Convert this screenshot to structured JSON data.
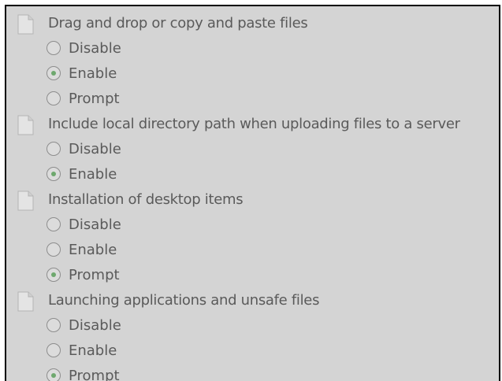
{
  "settings": [
    {
      "label": "Drag and drop or copy and paste files",
      "icon": "document-icon",
      "options": [
        {
          "label": "Disable",
          "checked": false
        },
        {
          "label": "Enable",
          "checked": true
        },
        {
          "label": "Prompt",
          "checked": false
        }
      ]
    },
    {
      "label": "Include local directory path when uploading files to a server",
      "icon": "document-icon",
      "options": [
        {
          "label": "Disable",
          "checked": false
        },
        {
          "label": "Enable",
          "checked": true
        }
      ]
    },
    {
      "label": "Installation of desktop items",
      "icon": "document-icon",
      "options": [
        {
          "label": "Disable",
          "checked": false
        },
        {
          "label": "Enable",
          "checked": false
        },
        {
          "label": "Prompt",
          "checked": true
        }
      ]
    },
    {
      "label": "Launching applications and unsafe files",
      "icon": "document-icon",
      "options": [
        {
          "label": "Disable",
          "checked": false
        },
        {
          "label": "Enable",
          "checked": false
        },
        {
          "label": "Prompt",
          "checked": true
        }
      ]
    }
  ],
  "colors": {
    "panel_background": "#d4d4d4",
    "text": "#5a5a5a",
    "radio_dot": "#6ea86e"
  }
}
